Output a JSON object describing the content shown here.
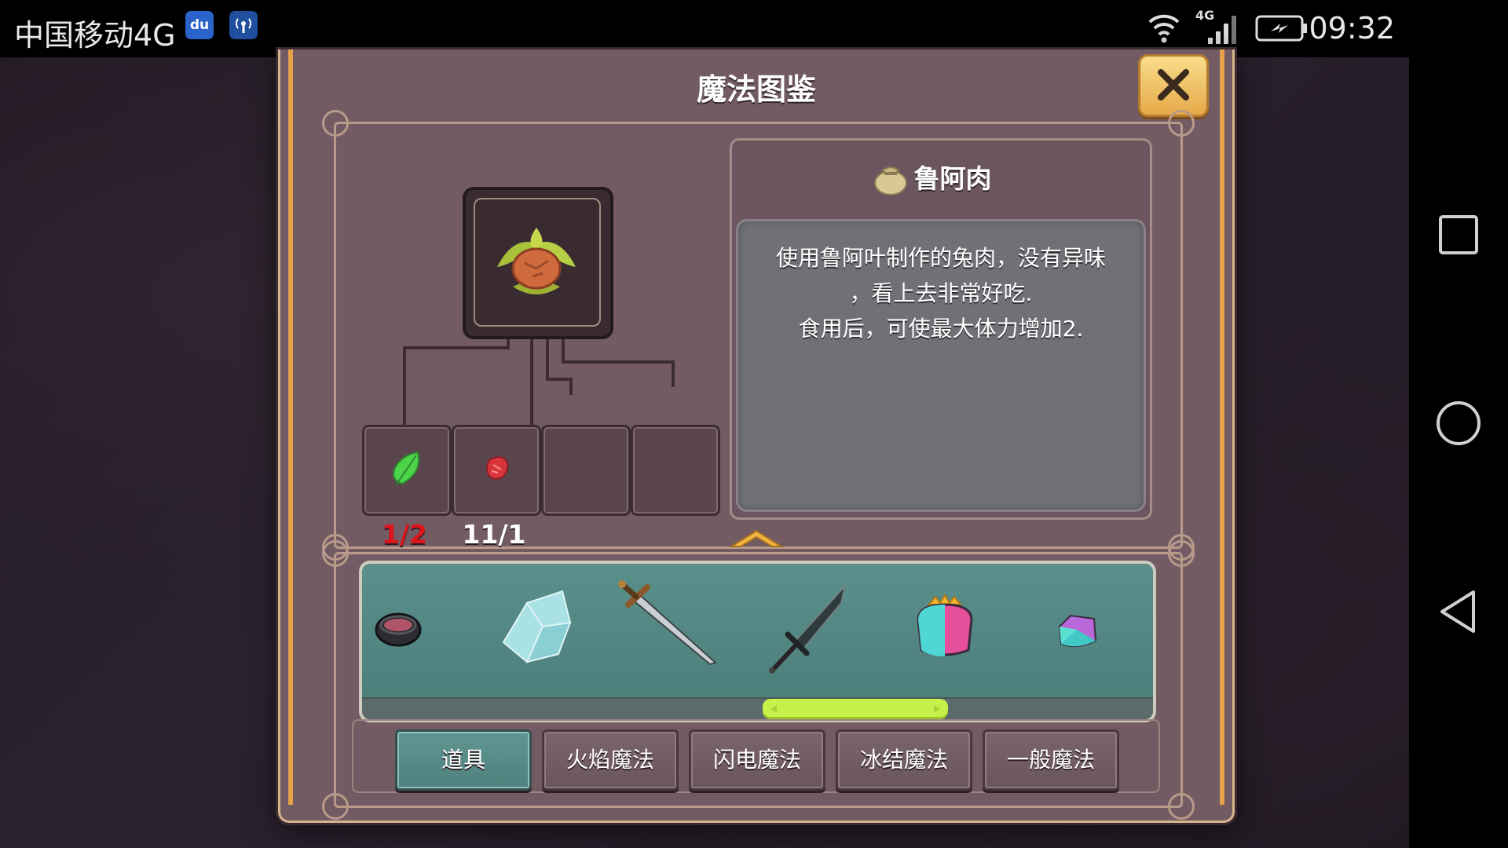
{
  "status_bar": {
    "carrier": "中国移动4G",
    "app_icon_1": "du",
    "network_label": "4G",
    "time": "09:32"
  },
  "window": {
    "title": "魔法图鉴",
    "close_label": "✕"
  },
  "recipe": {
    "ingredients": [
      {
        "icon": "green-leaf-icon",
        "count": "1/2",
        "count_color": "#e0141c"
      },
      {
        "icon": "raw-meat-icon",
        "count": "11/1",
        "count_color": "#ffffff"
      },
      {
        "icon": "",
        "count": ""
      },
      {
        "icon": "",
        "count": ""
      }
    ]
  },
  "item_info": {
    "name": "鲁阿肉",
    "icon": "pouch-icon",
    "description_lines": [
      "使用鲁阿叶制作的兔肉，没有异味",
      "，看上去非常好吃.",
      "食用后，可使最大体力增加2."
    ]
  },
  "carousel": {
    "items": [
      "bowl-icon",
      "ice-crystal-icon",
      "bronze-sword-icon",
      "dark-sword-icon",
      "crown-gem-icon",
      "small-gem-icon"
    ],
    "scroll_position": 0.62
  },
  "tabs": [
    {
      "label": "道具",
      "active": true
    },
    {
      "label": "火焰魔法",
      "active": false
    },
    {
      "label": "闪电魔法",
      "active": false
    },
    {
      "label": "冰结魔法",
      "active": false
    },
    {
      "label": "一般魔法",
      "active": false
    }
  ],
  "colors": {
    "accent_gold": "#e6a24a",
    "tab_active": "#5a8f8b",
    "scroll_thumb": "#c8f04a",
    "shortfall_red": "#e0141c"
  }
}
